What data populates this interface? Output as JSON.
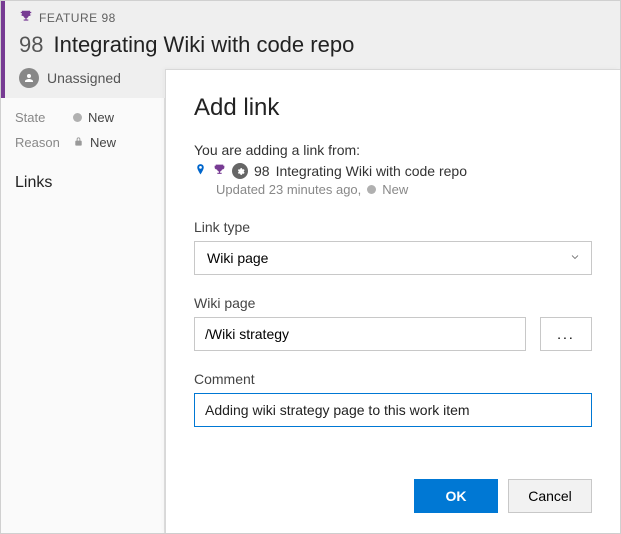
{
  "workItem": {
    "typeLabel": "FEATURE 98",
    "id": "98",
    "title": "Integrating Wiki with code repo",
    "assignee": "Unassigned",
    "stateLabel": "State",
    "stateValue": "New",
    "reasonLabel": "Reason",
    "reasonValue": "New"
  },
  "sidebar": {
    "linksHeader": "Links"
  },
  "dialog": {
    "title": "Add link",
    "intro": "You are adding a link from:",
    "refId": "98",
    "refTitle": "Integrating Wiki with code repo",
    "updatedText": "Updated 23 minutes ago,",
    "refState": "New",
    "linkTypeLabel": "Link type",
    "linkTypeValue": "Wiki page",
    "wikiPageLabel": "Wiki page",
    "wikiPageValue": "/Wiki strategy",
    "browseLabel": "...",
    "commentLabel": "Comment",
    "commentValue": "Adding wiki strategy page to this work item",
    "okLabel": "OK",
    "cancelLabel": "Cancel"
  }
}
